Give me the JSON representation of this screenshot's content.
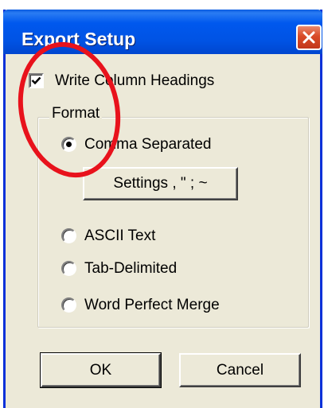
{
  "window": {
    "title": "Export Setup",
    "close_icon": "close-icon"
  },
  "options": {
    "write_column_headings": {
      "label": "Write Column Headings",
      "checked": true
    }
  },
  "format": {
    "legend": "Format",
    "selected": "Comma Separated",
    "options": [
      {
        "label": "Comma Separated",
        "selected": true
      },
      {
        "label": "ASCII Text",
        "selected": false
      },
      {
        "label": "Tab-Delimited",
        "selected": false
      },
      {
        "label": "Word Perfect Merge",
        "selected": false
      }
    ],
    "settings_button": "Settings  , \" ; ~"
  },
  "buttons": {
    "ok": "OK",
    "cancel": "Cancel"
  },
  "colors": {
    "titlebar": "#0054e3",
    "dialog_bg": "#ece9d8",
    "close_button": "#d94a27",
    "annotation": "#e8121c"
  }
}
